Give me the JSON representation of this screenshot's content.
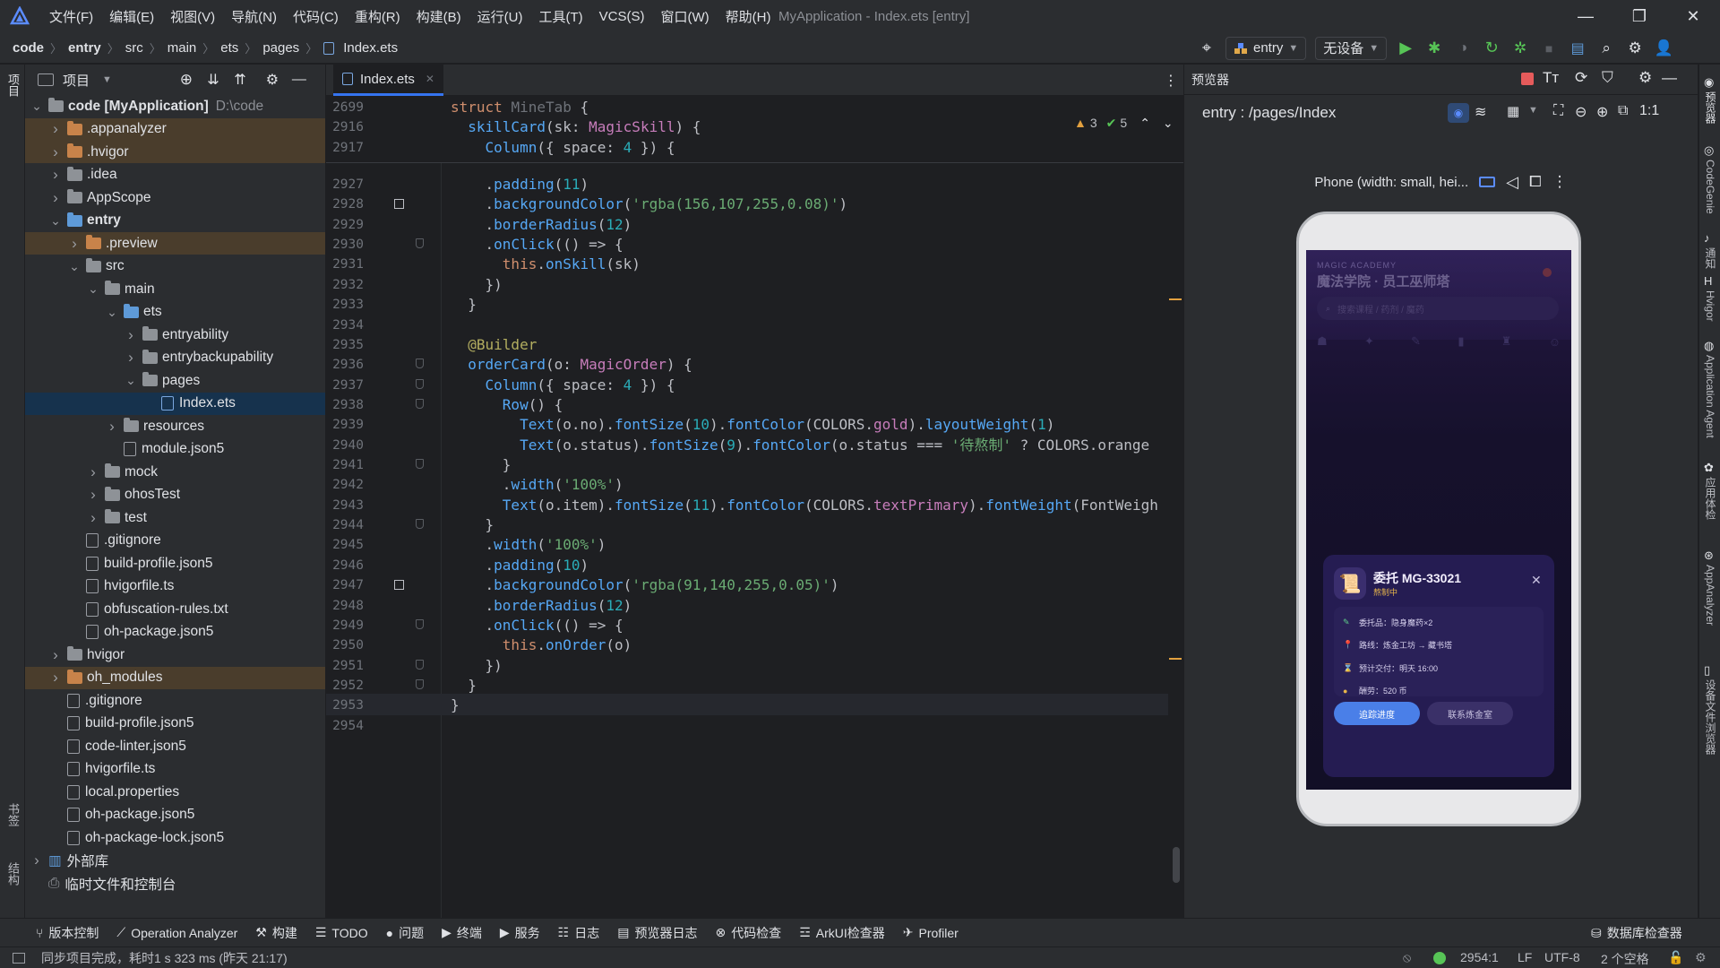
{
  "titlebar": {
    "menus": [
      "文件(F)",
      "编辑(E)",
      "视图(V)",
      "导航(N)",
      "代码(C)",
      "重构(R)",
      "构建(B)",
      "运行(U)",
      "工具(T)",
      "VCS(S)",
      "窗口(W)",
      "帮助(H)"
    ],
    "title": "MyApplication - Index.ets [entry]"
  },
  "breadcrumb": [
    "code",
    "entry",
    "src",
    "main",
    "ets",
    "pages",
    "Index.ets"
  ],
  "toolbar": {
    "run_config": "entry",
    "device": "无设备"
  },
  "project": {
    "header": "项目",
    "tree": [
      {
        "indent": 0,
        "chev": "v",
        "kind": "folder-gray",
        "label": "code [MyApplication]",
        "muted": "D:\\code",
        "bold": true
      },
      {
        "indent": 1,
        "chev": ">",
        "kind": "folder-orange",
        "label": ".appanalyzer",
        "bg": "excl"
      },
      {
        "indent": 1,
        "chev": ">",
        "kind": "folder-orange",
        "label": ".hvigor",
        "bg": "excl"
      },
      {
        "indent": 1,
        "chev": ">",
        "kind": "folder-gray",
        "label": ".idea"
      },
      {
        "indent": 1,
        "chev": ">",
        "kind": "folder-gray",
        "label": "AppScope"
      },
      {
        "indent": 1,
        "chev": "v",
        "kind": "folder-blue",
        "label": "entry",
        "bold": true
      },
      {
        "indent": 2,
        "chev": ">",
        "kind": "folder-orange",
        "label": ".preview",
        "bg": "excl"
      },
      {
        "indent": 2,
        "chev": "v",
        "kind": "folder-gray",
        "label": "src"
      },
      {
        "indent": 3,
        "chev": "v",
        "kind": "folder-gray",
        "label": "main"
      },
      {
        "indent": 4,
        "chev": "v",
        "kind": "folder-blue",
        "label": "ets"
      },
      {
        "indent": 5,
        "chev": ">",
        "kind": "folder-gray",
        "label": "entryability"
      },
      {
        "indent": 5,
        "chev": ">",
        "kind": "folder-gray",
        "label": "entrybackupability"
      },
      {
        "indent": 5,
        "chev": "v",
        "kind": "folder-gray",
        "label": "pages"
      },
      {
        "indent": 6,
        "chev": "",
        "kind": "file-ets",
        "label": "Index.ets",
        "bg": "sel"
      },
      {
        "indent": 4,
        "chev": ">",
        "kind": "folder-gray",
        "label": "resources"
      },
      {
        "indent": 4,
        "chev": "",
        "kind": "file",
        "label": "module.json5"
      },
      {
        "indent": 3,
        "chev": ">",
        "kind": "folder-gray",
        "label": "mock"
      },
      {
        "indent": 3,
        "chev": ">",
        "kind": "folder-gray",
        "label": "ohosTest"
      },
      {
        "indent": 3,
        "chev": ">",
        "kind": "folder-gray",
        "label": "test"
      },
      {
        "indent": 2,
        "chev": "",
        "kind": "file",
        "label": ".gitignore"
      },
      {
        "indent": 2,
        "chev": "",
        "kind": "file",
        "label": "build-profile.json5"
      },
      {
        "indent": 2,
        "chev": "",
        "kind": "file",
        "label": "hvigorfile.ts"
      },
      {
        "indent": 2,
        "chev": "",
        "kind": "file",
        "label": "obfuscation-rules.txt"
      },
      {
        "indent": 2,
        "chev": "",
        "kind": "file",
        "label": "oh-package.json5"
      },
      {
        "indent": 1,
        "chev": ">",
        "kind": "folder-gray",
        "label": "hvigor"
      },
      {
        "indent": 1,
        "chev": ">",
        "kind": "folder-orange",
        "label": "oh_modules",
        "bg": "excl"
      },
      {
        "indent": 1,
        "chev": "",
        "kind": "file",
        "label": ".gitignore"
      },
      {
        "indent": 1,
        "chev": "",
        "kind": "file",
        "label": "build-profile.json5"
      },
      {
        "indent": 1,
        "chev": "",
        "kind": "file",
        "label": "code-linter.json5"
      },
      {
        "indent": 1,
        "chev": "",
        "kind": "file",
        "label": "hvigorfile.ts"
      },
      {
        "indent": 1,
        "chev": "",
        "kind": "file",
        "label": "local.properties"
      },
      {
        "indent": 1,
        "chev": "",
        "kind": "file",
        "label": "oh-package.json5"
      },
      {
        "indent": 1,
        "chev": "",
        "kind": "file",
        "label": "oh-package-lock.json5"
      },
      {
        "indent": 0,
        "chev": ">",
        "kind": "lib",
        "label": "外部库"
      },
      {
        "indent": 0,
        "chev": "",
        "kind": "scratch",
        "label": "临时文件和控制台"
      }
    ]
  },
  "editor": {
    "tab": "Index.ets",
    "warnings": "3",
    "checks": "5",
    "sticky": [
      {
        "ln": "2699",
        "html": "<span class='kw'>struct</span> <span style='color:#6f737a'>MineTab</span> {"
      },
      {
        "ln": "2916",
        "html": "  <span class='fn'>skillCard</span>(sk: <span class='ty'>MagicSkill</span>) {"
      },
      {
        "ln": "2917",
        "html": "    <span class='fn'>Column</span>({ space: <span class='num'>4</span> }) {"
      }
    ],
    "lines": [
      {
        "ln": "2927",
        "html": "    .<span class='fn'>padding</span>(<span class='num'>11</span>)"
      },
      {
        "ln": "2928",
        "html": "    .<span class='fn'>backgroundColor</span>(<span class='str'>'rgba(156,107,255,0.08)'</span>)"
      },
      {
        "ln": "2929",
        "html": "    .<span class='fn'>borderRadius</span>(<span class='num'>12</span>)"
      },
      {
        "ln": "2930",
        "html": "    .<span class='fn'>onClick</span>(() => {"
      },
      {
        "ln": "2931",
        "html": "      <span class='kw'>this</span>.<span class='fn'>onSkill</span>(sk)"
      },
      {
        "ln": "2932",
        "html": "    })"
      },
      {
        "ln": "2933",
        "html": "  }"
      },
      {
        "ln": "2934",
        "html": ""
      },
      {
        "ln": "2935",
        "html": "  <span class='an'>@Builder</span>"
      },
      {
        "ln": "2936",
        "html": "  <span class='fn'>orderCard</span>(o: <span class='ty'>MagicOrder</span>) {"
      },
      {
        "ln": "2937",
        "html": "    <span class='fn'>Column</span>({ space: <span class='num'>4</span> }) {"
      },
      {
        "ln": "2938",
        "html": "      <span class='fn'>Row</span>() {"
      },
      {
        "ln": "2939",
        "html": "        <span class='fn'>Text</span>(o.no).<span class='fn'>fontSize</span>(<span class='num'>10</span>).<span class='fn'>fontColor</span>(COLORS.<span class='prop'>gold</span>).<span class='fn'>layoutWeight</span>(<span class='num'>1</span>)"
      },
      {
        "ln": "2940",
        "html": "        <span class='fn'>Text</span>(o.status).<span class='fn'>fontSize</span>(<span class='num'>9</span>).<span class='fn'>fontColor</span>(o.status === <span class='str'>'待熬制'</span> ? COLORS.orange"
      },
      {
        "ln": "2941",
        "html": "      }"
      },
      {
        "ln": "2942",
        "html": "      .<span class='fn'>width</span>(<span class='str'>'100%'</span>)"
      },
      {
        "ln": "2943",
        "html": "      <span class='fn'>Text</span>(o.item).<span class='fn'>fontSize</span>(<span class='num'>11</span>).<span class='fn'>fontColor</span>(COLORS.<span class='prop'>textPrimary</span>).<span class='fn'>fontWeight</span>(FontWeigh"
      },
      {
        "ln": "2944",
        "html": "    }"
      },
      {
        "ln": "2945",
        "html": "    .<span class='fn'>width</span>(<span class='str'>'100%'</span>)"
      },
      {
        "ln": "2946",
        "html": "    .<span class='fn'>padding</span>(<span class='num'>10</span>)"
      },
      {
        "ln": "2947",
        "html": "    .<span class='fn'>backgroundColor</span>(<span class='str'>'rgba(91,140,255,0.05)'</span>)"
      },
      {
        "ln": "2948",
        "html": "    .<span class='fn'>borderRadius</span>(<span class='num'>12</span>)"
      },
      {
        "ln": "2949",
        "html": "    .<span class='fn'>onClick</span>(() => {"
      },
      {
        "ln": "2950",
        "html": "      <span class='kw'>this</span>.<span class='fn'>onOrder</span>(o)"
      },
      {
        "ln": "2951",
        "html": "    })"
      },
      {
        "ln": "2952",
        "html": "  }"
      },
      {
        "ln": "2953",
        "html": "}"
      },
      {
        "ln": "2954",
        "html": ""
      }
    ]
  },
  "preview": {
    "panel_title": "预览器",
    "route": "entry : /pages/Index",
    "device_label": "Phone (width: small, hei...",
    "app": {
      "subtitle": "MAGIC ACADEMY",
      "title": "魔法学院 · 员工巫师塔",
      "search_placeholder": "搜索课程 / 药剂 / 魔药",
      "dialog": {
        "title": "委托 MG-33021",
        "status": "熬制中",
        "rows": [
          {
            "icon": "wand-icon",
            "text": "委托品：隐身魔药×2"
          },
          {
            "icon": "pin-icon",
            "text": "路线：炼金工坊 → 藏书塔"
          },
          {
            "icon": "hourglass-icon",
            "text": "预计交付：明天 16:00"
          },
          {
            "icon": "coin-icon",
            "text": "酬劳：520 币"
          }
        ],
        "primary_btn": "追踪进度",
        "secondary_btn": "联系炼金室"
      }
    }
  },
  "bottombar": {
    "left": [
      "版本控制",
      "Operation Analyzer",
      "构建",
      "TODO",
      "问题",
      "终端",
      "服务",
      "日志",
      "预览器日志",
      "代码检查",
      "ArkUI检查器",
      "Profiler"
    ],
    "right": "数据库检查器"
  },
  "statusbar": {
    "message": "同步项目完成，耗时1 s 323 ms (昨天 21:17)",
    "position": "2954:1",
    "line_sep": "LF",
    "encoding": "UTF-8",
    "indent": "2 个空格"
  },
  "right_stripe": [
    "预览器",
    "CodeGenie",
    "通知",
    "Hvigor",
    "Application Agent",
    "应用体检",
    "AppAnalyzer",
    "设备文件浏览器"
  ],
  "left_stripe": [
    "项目",
    "书签",
    "结构"
  ]
}
